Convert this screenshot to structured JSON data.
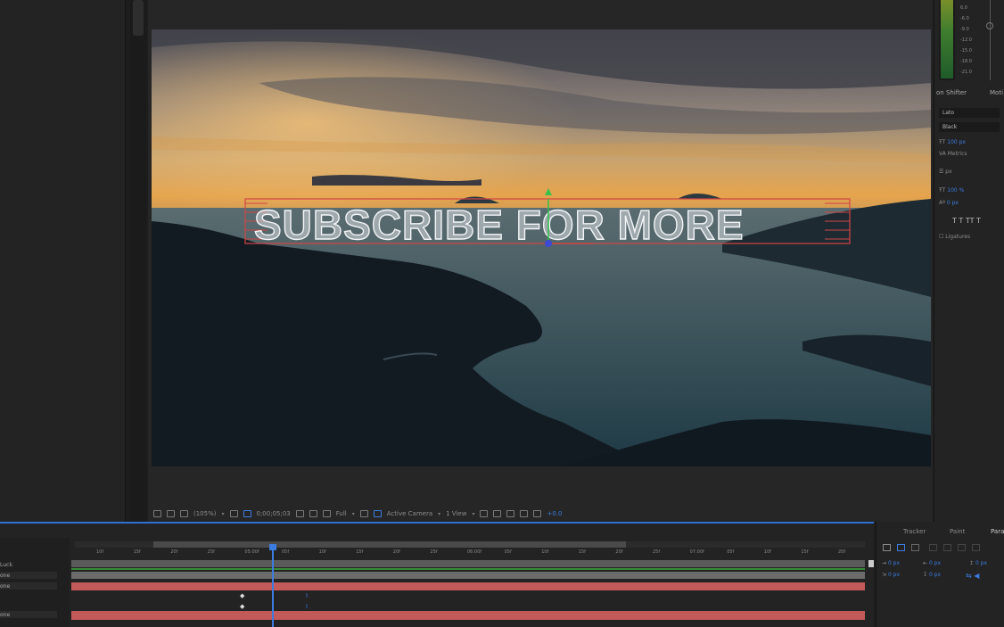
{
  "composition": {
    "title_text": "SUBSCRIBE FOR MORE"
  },
  "viewer_toolbar": {
    "zoom": "(105%)",
    "timecode": "0;00;05;03",
    "resolution": "Full",
    "camera": "Active Camera",
    "views": "1 View",
    "exposure": "+0.0"
  },
  "meter": {
    "labels": [
      "6.0",
      "-6.0",
      "-9.0",
      "-12.0",
      "-15.0",
      "-18.0",
      "-21.0",
      "-24.0"
    ]
  },
  "character_panel": {
    "tab_left": "on Shifter",
    "tab_right": "Moti",
    "font_family": "Lato",
    "font_style": "Black",
    "size_value": "100 px",
    "tracking_row": "Metrics",
    "leading_unit": "px",
    "vscale": "100 %",
    "baseline": "0 px",
    "style_buttons": "T  T  TT  T",
    "ligatures": "Ligatures"
  },
  "timeline": {
    "layers": [
      {
        "name": "Luck",
        "mode": ""
      },
      {
        "name": "",
        "mode": "one"
      },
      {
        "name": "",
        "mode": "one"
      },
      {
        "name": "",
        "mode": "one"
      }
    ],
    "ruler_ticks": [
      "10f",
      "15f",
      "20f",
      "25f",
      "05:00f",
      "05f",
      "10f",
      "15f",
      "20f",
      "25f",
      "06:00f",
      "05f",
      "10f",
      "15f",
      "20f",
      "25f",
      "07:00f",
      "05f",
      "10f",
      "15f",
      "20f"
    ]
  },
  "bottom_right_panel": {
    "tabs": [
      "Tracker",
      "Paint",
      "Parag"
    ],
    "indent_left": "0 px",
    "indent_right": "0 px",
    "space_before": "0 px",
    "space_after": "0 px",
    "indent_first": "0 px"
  }
}
